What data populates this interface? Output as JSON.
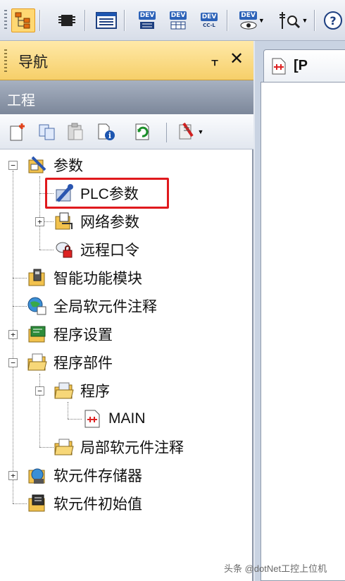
{
  "navigation": {
    "title": "导航",
    "pin_glyph": "ᚁ",
    "close_glyph": "✕"
  },
  "project": {
    "section_title": "工程"
  },
  "toolbar": {
    "dev_labels": [
      "DEV",
      "DEV",
      "DEV"
    ],
    "dev_sub_labels": [
      "",
      "",
      "CC-L"
    ],
    "dev_monitor_label": "DEV"
  },
  "tree": {
    "nodes": [
      {
        "label": "参数",
        "icon": "parameter-icon",
        "expanded": true
      },
      {
        "label": "PLC参数",
        "icon": "plc-parameter-icon",
        "highlighted": true
      },
      {
        "label": "网络参数",
        "icon": "network-parameter-icon",
        "expanded": false
      },
      {
        "label": "远程口令",
        "icon": "remote-password-icon"
      },
      {
        "label": "智能功能模块",
        "icon": "intelligent-module-icon"
      },
      {
        "label": "全局软元件注释",
        "icon": "global-device-comment-icon"
      },
      {
        "label": "程序设置",
        "icon": "program-setting-icon",
        "expanded": false
      },
      {
        "label": "程序部件",
        "icon": "program-parts-icon",
        "expanded": true
      },
      {
        "label": "程序",
        "icon": "program-folder-icon",
        "expanded": true
      },
      {
        "label": "MAIN",
        "icon": "ladder-program-icon"
      },
      {
        "label": "局部软元件注释",
        "icon": "local-device-comment-icon"
      },
      {
        "label": "软元件存储器",
        "icon": "device-memory-icon",
        "expanded": false
      },
      {
        "label": "软元件初始值",
        "icon": "device-initial-value-icon"
      }
    ]
  },
  "document": {
    "tab_label": "[P"
  },
  "watermark": "头条 @dotNet工控上位机",
  "colors": {
    "highlight_border": "#e0191d",
    "nav_header": "#f6cf69",
    "project_bar": "#8f9aac",
    "active_tool": "#ffd873"
  }
}
